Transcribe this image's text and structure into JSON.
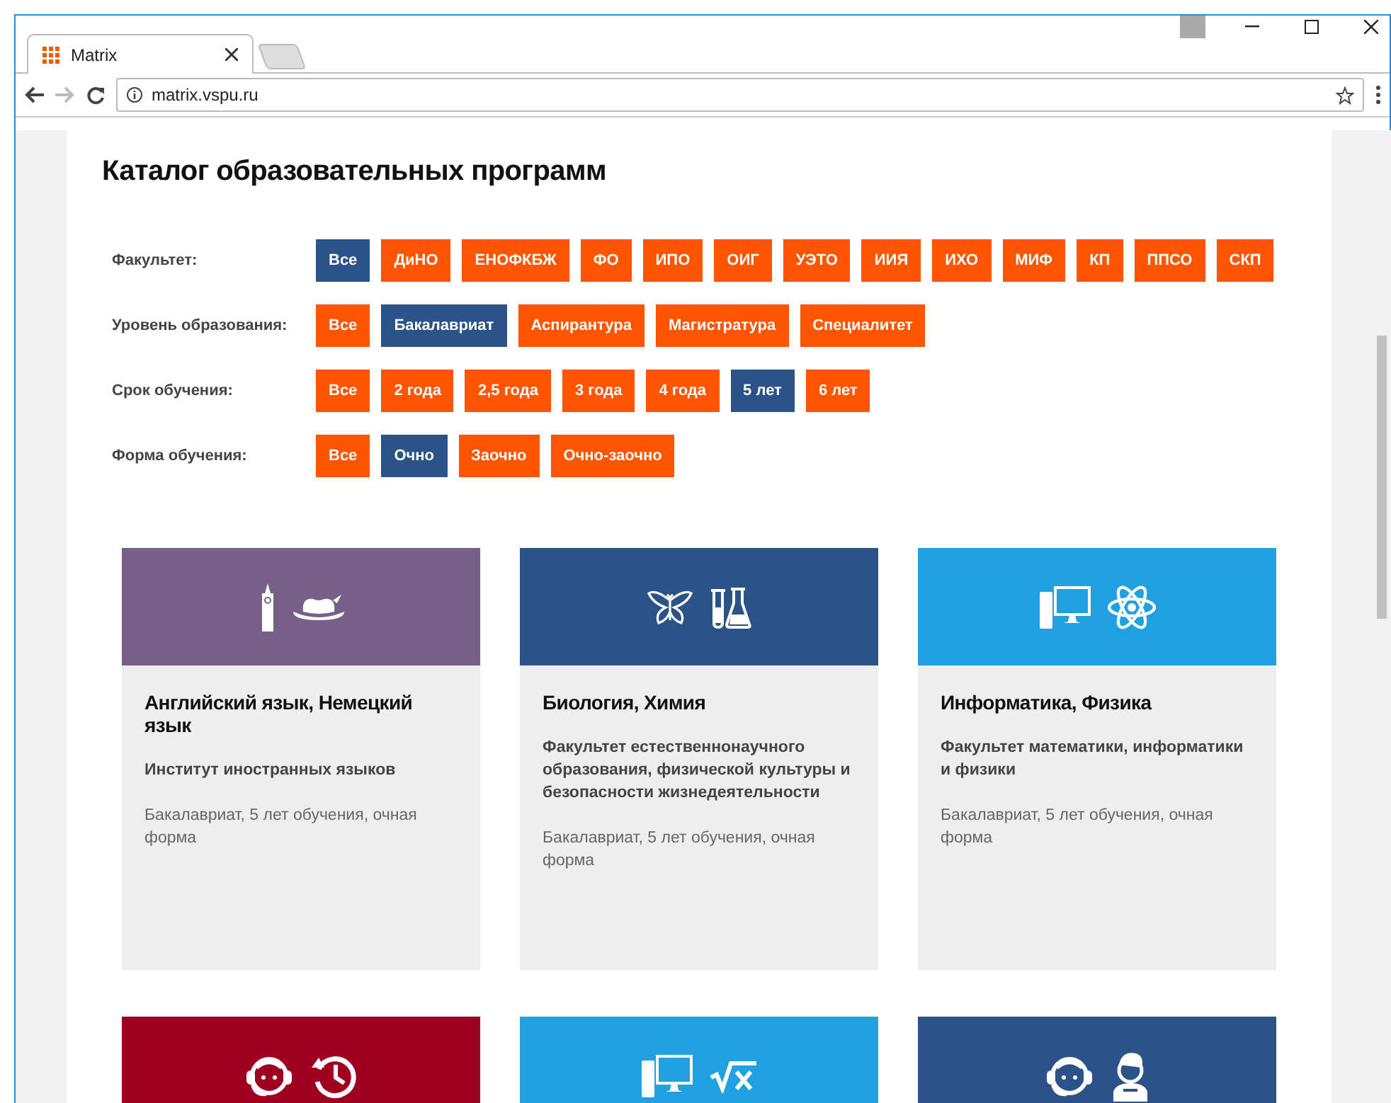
{
  "browser": {
    "tab_title": "Matrix",
    "url": "matrix.vspu.ru"
  },
  "page": {
    "title": "Каталог образовательных программ",
    "filters": [
      {
        "label": "Факультет:",
        "options": [
          {
            "label": "Все",
            "selected": true
          },
          {
            "label": "ДиНО",
            "selected": false
          },
          {
            "label": "ЕНОФКБЖ",
            "selected": false
          },
          {
            "label": "ФО",
            "selected": false
          },
          {
            "label": "ИПО",
            "selected": false
          },
          {
            "label": "ОИГ",
            "selected": false
          },
          {
            "label": "УЭТО",
            "selected": false
          },
          {
            "label": "ИИЯ",
            "selected": false
          },
          {
            "label": "ИХО",
            "selected": false
          },
          {
            "label": "МИФ",
            "selected": false
          },
          {
            "label": "КП",
            "selected": false
          },
          {
            "label": "ППСО",
            "selected": false
          },
          {
            "label": "СКП",
            "selected": false
          }
        ]
      },
      {
        "label": "Уровень образования:",
        "options": [
          {
            "label": "Все",
            "selected": false
          },
          {
            "label": "Бакалавриат",
            "selected": true
          },
          {
            "label": "Аспирантура",
            "selected": false
          },
          {
            "label": "Магистратура",
            "selected": false
          },
          {
            "label": "Специалитет",
            "selected": false
          }
        ]
      },
      {
        "label": "Срок обучения:",
        "options": [
          {
            "label": "Все",
            "selected": false
          },
          {
            "label": "2 года",
            "selected": false
          },
          {
            "label": "2,5 года",
            "selected": false
          },
          {
            "label": "3 года",
            "selected": false
          },
          {
            "label": "4 года",
            "selected": false
          },
          {
            "label": "5 лет",
            "selected": true
          },
          {
            "label": "6 лет",
            "selected": false
          }
        ]
      },
      {
        "label": "Форма обучения:",
        "options": [
          {
            "label": "Все",
            "selected": false
          },
          {
            "label": "Очно",
            "selected": true
          },
          {
            "label": "Заочно",
            "selected": false
          },
          {
            "label": "Очно-заочно",
            "selected": false
          }
        ]
      }
    ],
    "cards": [
      {
        "color": "#785f88",
        "icons": [
          {
            "kind": "tower"
          },
          {
            "kind": "hat"
          }
        ],
        "title": "Английский язык, Немецкий язык",
        "faculty": "Институт иностранных языков",
        "details": "Бакалавриат, 5 лет обучения, очная форма"
      },
      {
        "color": "#2b5387",
        "icons": [
          {
            "kind": "butterfly"
          },
          {
            "kind": "flask"
          }
        ],
        "title": "Биология, Химия",
        "faculty": "Факультет естественнонаучного образования, физической культуры и безопасности жизнедеятельности",
        "details": "Бакалавриат, 5 лет обучения, очная форма"
      },
      {
        "color": "#1ea0e1",
        "icons": [
          {
            "kind": "computer"
          },
          {
            "kind": "atom"
          }
        ],
        "title": "Информатика, Физика",
        "faculty": "Факультет математики, информатики и физики",
        "details": "Бакалавриат, 5 лет обучения, очная форма"
      },
      {
        "color": "#a00020",
        "icons": [
          {
            "kind": "headset"
          },
          {
            "kind": "history"
          }
        ]
      },
      {
        "color": "#1ea0e1",
        "icons": [
          {
            "kind": "computer"
          },
          {
            "kind": "sqrt"
          }
        ]
      },
      {
        "color": "#2b5387",
        "icons": [
          {
            "kind": "headset"
          },
          {
            "kind": "person"
          }
        ]
      }
    ]
  }
}
